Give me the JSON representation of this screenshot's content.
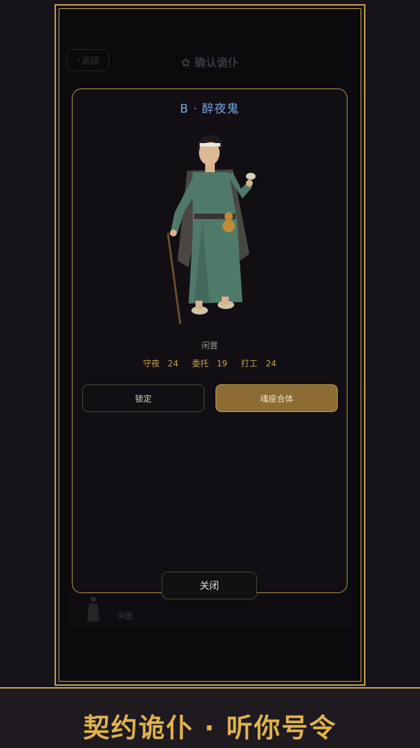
{
  "underlying": {
    "back_label": "返回",
    "title": "确认诡仆",
    "list_item_status": "闲置"
  },
  "modal": {
    "title": "B · 醉夜鬼",
    "status": "闲置",
    "stats": [
      {
        "label": "守夜",
        "value": "24"
      },
      {
        "label": "委托",
        "value": "19"
      },
      {
        "label": "打工",
        "value": "24"
      }
    ],
    "lock_label": "锁定",
    "merge_label": "魂座合体",
    "close_label": "关闭"
  },
  "banner": {
    "slogan": "契约诡仆 · 听你号令"
  },
  "colors": {
    "gold": "#c9a24a",
    "title_blue": "#7aa6e0",
    "merge_button": "#8a6c34"
  }
}
